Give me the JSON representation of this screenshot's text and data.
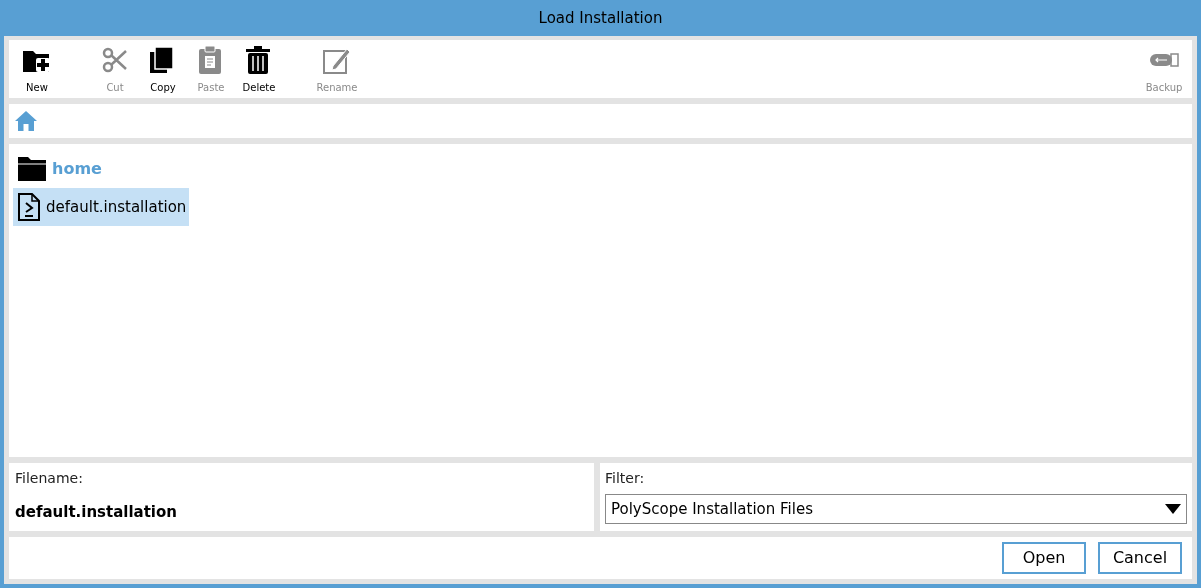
{
  "window": {
    "title": "Load Installation"
  },
  "toolbar": [
    {
      "kind": "new",
      "label": "New",
      "disabled": false
    },
    {
      "kind": "cut",
      "label": "Cut",
      "disabled": true
    },
    {
      "kind": "copy",
      "label": "Copy",
      "disabled": false
    },
    {
      "kind": "paste",
      "label": "Paste",
      "disabled": true
    },
    {
      "kind": "delete",
      "label": "Delete",
      "disabled": false
    },
    {
      "kind": "rename",
      "label": "Rename",
      "disabled": true
    },
    {
      "kind": "backup",
      "label": "Backup",
      "disabled": true
    }
  ],
  "files": [
    {
      "kind": "folder",
      "name": "home",
      "selected": false
    },
    {
      "kind": "installation",
      "name": "default.installation",
      "selected": true
    }
  ],
  "filename": {
    "label": "Filename:",
    "value": "default.installation"
  },
  "filter": {
    "label": "Filter:",
    "value": "PolyScope Installation Files"
  },
  "buttons": [
    "Open",
    "Cancel"
  ]
}
